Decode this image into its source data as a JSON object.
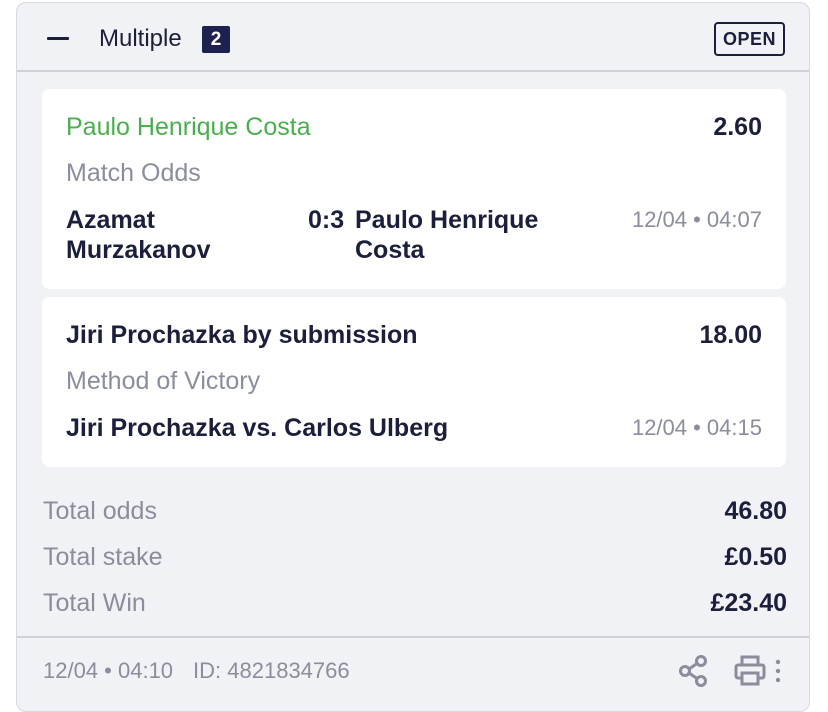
{
  "header": {
    "title": "Multiple",
    "count": "2",
    "status": "OPEN"
  },
  "selections": [
    {
      "name": "Paulo Henrique Costa",
      "odds": "2.60",
      "market": "Match Odds",
      "home_team": "Azamat Murzakanov",
      "score": "0:3",
      "away_team": "Paulo Henrique Costa",
      "kickoff": "12/04 • 04:07"
    },
    {
      "name": "Jiri Prochazka by submission",
      "odds": "18.00",
      "market": "Method of Victory",
      "event": "Jiri Prochazka vs. Carlos Ulberg",
      "kickoff": "12/04 • 04:15"
    }
  ],
  "summary": {
    "total_odds_label": "Total odds",
    "total_odds": "46.80",
    "total_stake_label": "Total stake",
    "total_stake": "£0.50",
    "total_win_label": "Total Win",
    "total_win": "£23.40"
  },
  "footer": {
    "placed": "12/04 • 04:10",
    "bet_id": "ID: 4821834766"
  },
  "colors": {
    "winning_selection": "#4aae4f",
    "primary_text": "#1b1f3b",
    "muted_text": "#8a8d9c",
    "badge_background": "#1c2150",
    "card_background": "#f1f2f5"
  },
  "icons": [
    "minus-icon",
    "share-icon",
    "print-icon",
    "more-vertical-icon"
  ]
}
